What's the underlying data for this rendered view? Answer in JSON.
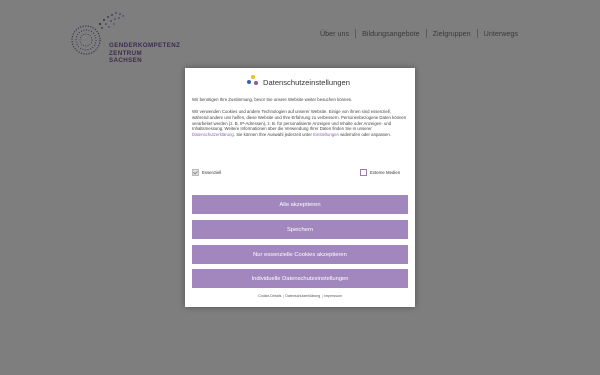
{
  "site": {
    "logo_line1": "GENDERKOMPETENZ",
    "logo_line2": "ZENTRUM SACHSEN",
    "nav": [
      "Über uns",
      "Bildungsangebote",
      "Zielgruppen",
      "Unterwegs"
    ]
  },
  "modal": {
    "title": "Datenschutzeinstellungen",
    "intro": "Wir benötigen Ihre Zustimmung, bevor Sie unsere Website weiter besuchen können.",
    "body_part1": "Wir verwenden Cookies und andere Technologien auf unserer Website. Einige von ihnen sind essenziell, während andere uns helfen, diese Website und Ihre Erfahrung zu verbessern. Personenbezogene Daten können verarbeitet werden (z. B. IP-Adressen), z. B. für personalisierte Anzeigen und Inhalte oder Anzeigen- und Inhaltsmessung. Weitere Informationen über die Verwendung Ihrer Daten finden Sie in unserer ",
    "privacy_link": "Datenschutzerklärung",
    "body_part2": ". Sie können Ihre Auswahl jederzeit unter ",
    "settings_link": "Einstellungen",
    "body_part3": " widerrufen oder anpassen.",
    "check_essential": "Essenziell",
    "check_external": "Externe Medien",
    "btn_accept_all": "Alle akzeptieren",
    "btn_save": "Speichern",
    "btn_essential_only": "Nur essenzielle Cookies akzeptieren",
    "btn_individual": "Individuelle Datenschutzeinstellungen",
    "footer_cookie": "Cookie-Details",
    "footer_privacy": "Datenschutzerklärung",
    "footer_imprint": "Impressum"
  },
  "colors": {
    "accent": "#a187be",
    "overlay": "#7e7e7e",
    "dot_blue": "#3b5db5",
    "dot_yellow": "#e8c21a",
    "dot_purple": "#8a58b0"
  }
}
